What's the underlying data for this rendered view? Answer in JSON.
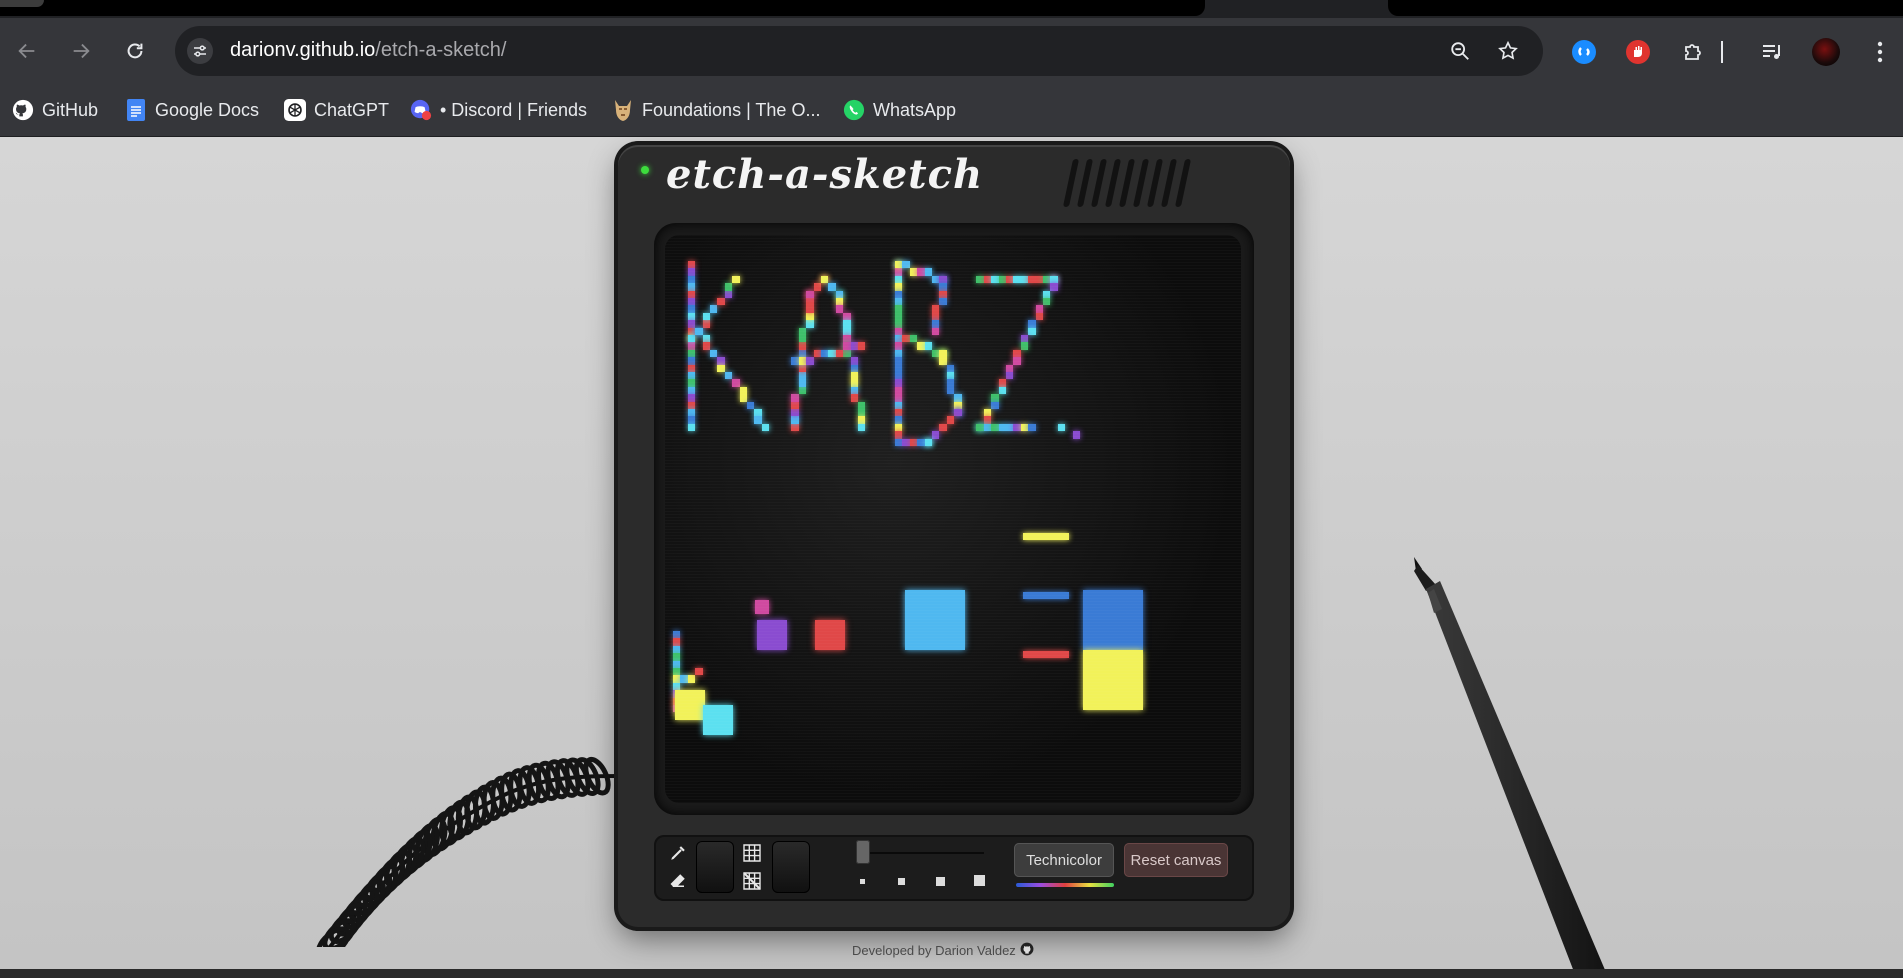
{
  "browser": {
    "url_domain": "darionv.github.io",
    "url_path": "/etch-a-sketch/",
    "bookmarks": [
      {
        "label": "GitHub",
        "icon": "github-icon"
      },
      {
        "label": "Google Docs",
        "icon": "google-docs-icon"
      },
      {
        "label": "ChatGPT",
        "icon": "chatgpt-icon"
      },
      {
        "label": "• Discord | Friends",
        "icon": "discord-icon"
      },
      {
        "label": "Foundations | The O...",
        "icon": "odin-project-icon"
      },
      {
        "label": "WhatsApp",
        "icon": "whatsapp-icon"
      }
    ],
    "extensions": [
      "shazam-icon",
      "adblock-icon",
      "extensions-puzzle-icon",
      "media-playlist-icon",
      "profile-avatar-icon"
    ]
  },
  "app": {
    "logo": "etch-a-sketch",
    "power_led_color": "#3ddc3d",
    "drawing_text": "KABZ.",
    "tools": {
      "pen": "pen-icon",
      "eraser": "eraser-icon",
      "grid_on": "grid-icon",
      "grid_off": "grid-off-icon"
    },
    "size_options": [
      "tiny",
      "small",
      "medium",
      "large"
    ],
    "selected_size": "tiny",
    "technicolor_label": "Technicolor",
    "reset_label": "Reset canvas",
    "palette": [
      "#3a7bd5",
      "#4fb8f0",
      "#f2f25a",
      "#e04848",
      "#8a4cd0",
      "#3fc06a",
      "#d04aa0",
      "#5ce0f0"
    ]
  },
  "footer": {
    "text": "Developed by Darion Valdez",
    "icon": "github-icon"
  }
}
